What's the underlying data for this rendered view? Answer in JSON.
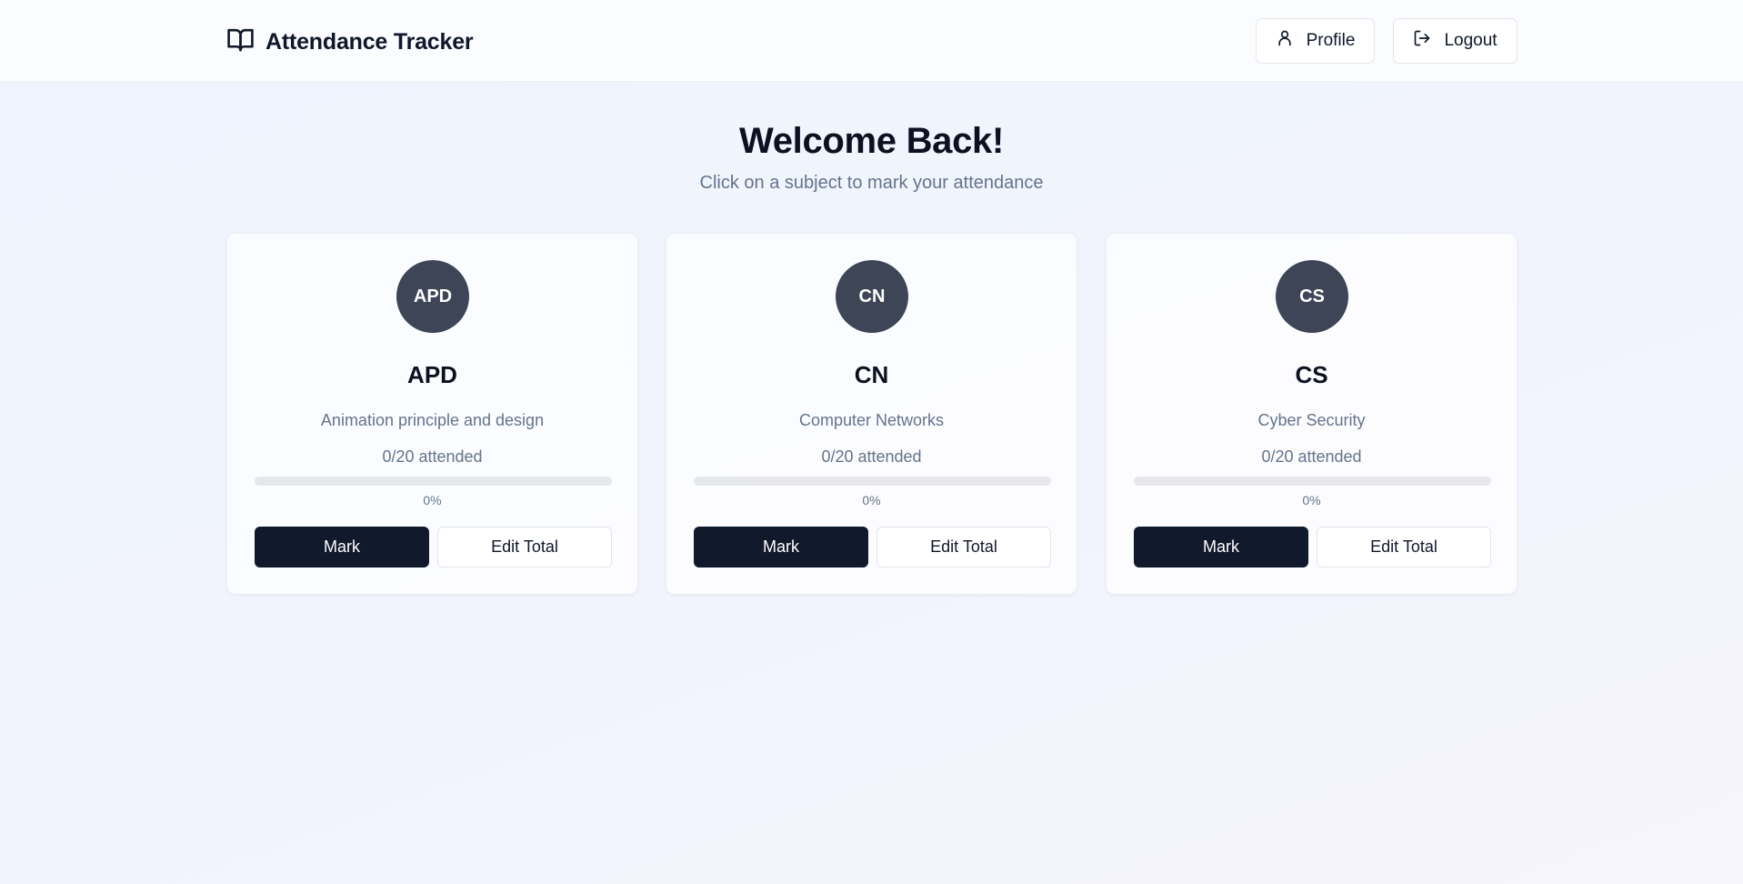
{
  "header": {
    "title": "Attendance Tracker",
    "icon": "book-open-icon",
    "profile_label": "Profile",
    "logout_label": "Logout"
  },
  "welcome": {
    "title": "Welcome Back!",
    "subtitle": "Click on a subject to mark your attendance"
  },
  "subjects": [
    {
      "initials": "APD",
      "code": "APD",
      "name": "Animation principle and design",
      "attended_text": "0/20 attended",
      "attended": 0,
      "total": 20,
      "percent_text": "0%",
      "percent": 0,
      "mark_label": "Mark",
      "edit_label": "Edit Total"
    },
    {
      "initials": "CN",
      "code": "CN",
      "name": "Computer Networks",
      "attended_text": "0/20 attended",
      "attended": 0,
      "total": 20,
      "percent_text": "0%",
      "percent": 0,
      "mark_label": "Mark",
      "edit_label": "Edit Total"
    },
    {
      "initials": "CS",
      "code": "CS",
      "name": "Cyber Security",
      "attended_text": "0/20 attended",
      "attended": 0,
      "total": 20,
      "percent_text": "0%",
      "percent": 0,
      "mark_label": "Mark",
      "edit_label": "Edit Total"
    }
  ],
  "colors": {
    "primary": "#111a2c",
    "avatar": "#3d4556",
    "muted_text": "#64748b",
    "progress_track": "#e5e7eb"
  }
}
